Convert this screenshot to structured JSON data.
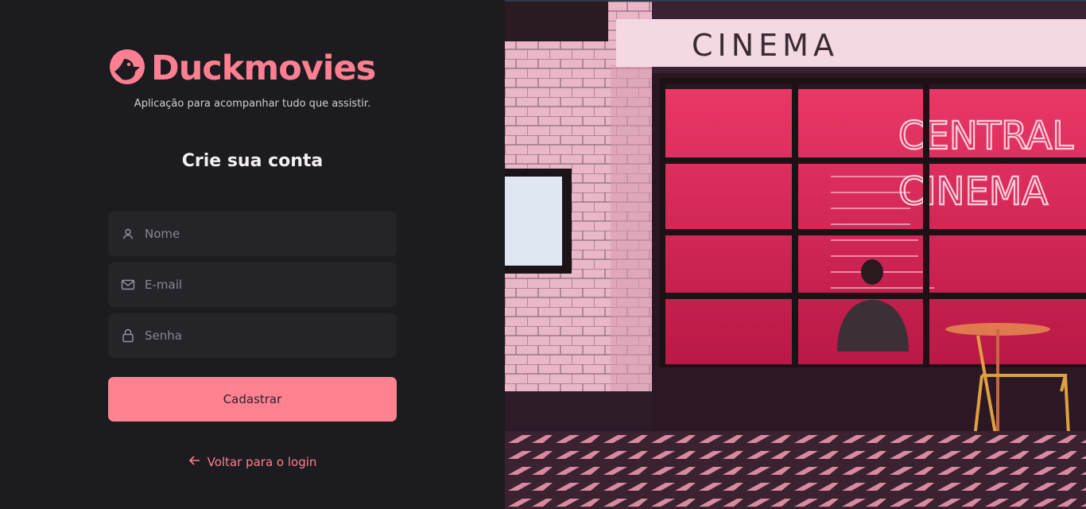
{
  "brand": {
    "name": "Duckmovies",
    "tagline": "Aplicação para acompanhar tudo que assistir.",
    "logo_icon": "duck-icon"
  },
  "form": {
    "heading": "Crie sua conta",
    "name_placeholder": "Nome",
    "email_placeholder": "E-mail",
    "password_placeholder": "Senha",
    "submit_label": "Cadastrar",
    "back_label": "Voltar para o login"
  },
  "hero": {
    "sign_text": "CINEMA",
    "neon_line1": "CENTRAL",
    "neon_line2": "CINEMA"
  },
  "colors": {
    "accent": "#ff8291",
    "background": "#1c1b1f",
    "field": "#252429"
  }
}
